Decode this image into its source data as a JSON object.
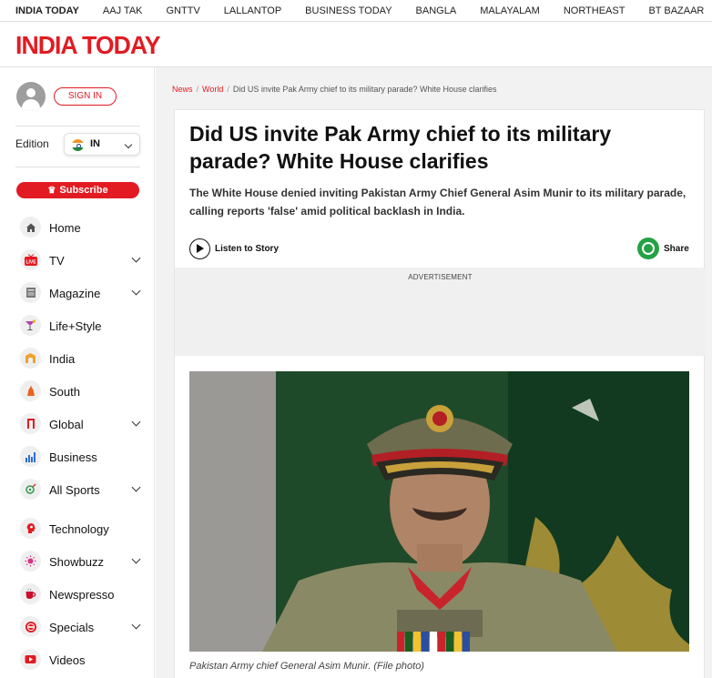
{
  "top_nav": [
    "INDIA TODAY",
    "AAJ TAK",
    "GNTTV",
    "LALLANTOP",
    "BUSINESS TODAY",
    "BANGLA",
    "MALAYALAM",
    "NORTHEAST",
    "BT BAZAAR"
  ],
  "brand": {
    "logo_text": "INDIA TODAY"
  },
  "sidebar": {
    "sign_in": "SIGN IN",
    "edition_label": "Edition",
    "edition_value": "IN",
    "subscribe": "Subscribe",
    "items": [
      {
        "label": "Home",
        "icon": "home-icon",
        "expandable": false
      },
      {
        "label": "TV",
        "icon": "live-tv-icon",
        "expandable": true
      },
      {
        "label": "Magazine",
        "icon": "magazine-icon",
        "expandable": true
      },
      {
        "label": "Life+Style",
        "icon": "cocktail-icon",
        "expandable": false
      },
      {
        "label": "India",
        "icon": "gate-icon",
        "expandable": false
      },
      {
        "label": "South",
        "icon": "temple-icon",
        "expandable": false
      },
      {
        "label": "Global",
        "icon": "global-icon",
        "expandable": true
      },
      {
        "label": "Business",
        "icon": "bar-chart-icon",
        "expandable": false
      },
      {
        "label": "All Sports",
        "icon": "sports-icon",
        "expandable": true
      },
      {
        "label": "Technology",
        "icon": "technology-icon",
        "expandable": false
      },
      {
        "label": "Showbuzz",
        "icon": "showbuzz-icon",
        "expandable": true
      },
      {
        "label": "Newspresso",
        "icon": "coffee-icon",
        "expandable": false
      },
      {
        "label": "Specials",
        "icon": "specials-icon",
        "expandable": true
      },
      {
        "label": "Videos",
        "icon": "video-icon",
        "expandable": false
      }
    ]
  },
  "breadcrumb": {
    "news": "News",
    "world": "World",
    "current": "Did US invite Pak Army chief to its military parade? White House clarifies"
  },
  "article": {
    "headline": "Did US invite Pak Army chief to its military parade? White House clarifies",
    "summary": "The White House denied inviting Pakistan Army Chief General Asim Munir to its military parade, calling reports 'false' amid political backlash in India.",
    "listen": "Listen to Story",
    "share": "Share",
    "ad_label": "ADVERTISEMENT",
    "caption": "Pakistan Army chief General Asim Munir. (File photo)"
  },
  "colors": {
    "brand_red": "#e21b22",
    "whatsapp_green": "#25a244"
  }
}
